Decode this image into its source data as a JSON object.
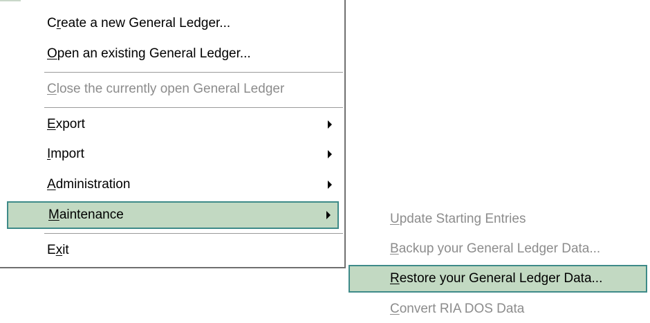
{
  "file_menu": {
    "items": [
      {
        "label": "Create a new General Ledger...",
        "accel": "r",
        "enabled": true
      },
      {
        "label": "Open an existing General Ledger...",
        "accel": "O",
        "enabled": true
      },
      {
        "label": "Close the currently open General Ledger",
        "accel": "C",
        "enabled": false
      },
      {
        "label": "Export",
        "accel": "E",
        "enabled": true,
        "submenu": true
      },
      {
        "label": "Import",
        "accel": "I",
        "enabled": true,
        "submenu": true
      },
      {
        "label": "Administration",
        "accel": "A",
        "enabled": true,
        "submenu": true
      },
      {
        "label": "Maintenance",
        "accel": "M",
        "enabled": true,
        "submenu": true,
        "selected": true
      },
      {
        "label": "Exit",
        "accel": "x",
        "enabled": true
      }
    ]
  },
  "maintenance_submenu": {
    "items": [
      {
        "label": "Update Starting Entries",
        "accel": "U",
        "enabled": false
      },
      {
        "label": "Backup your General Ledger Data...",
        "accel": "B",
        "enabled": false
      },
      {
        "label": "Restore your General Ledger Data...",
        "accel": "R",
        "enabled": true,
        "selected": true
      },
      {
        "label": "Convert RIA DOS Data",
        "accel": "C",
        "enabled": false
      }
    ]
  },
  "colors": {
    "highlight_fill": "#c2d9c2",
    "highlight_border": "#3d8a88",
    "disabled_text": "#8c8c8c"
  },
  "icons": {
    "submenu_arrow": "chevron-right-icon"
  }
}
